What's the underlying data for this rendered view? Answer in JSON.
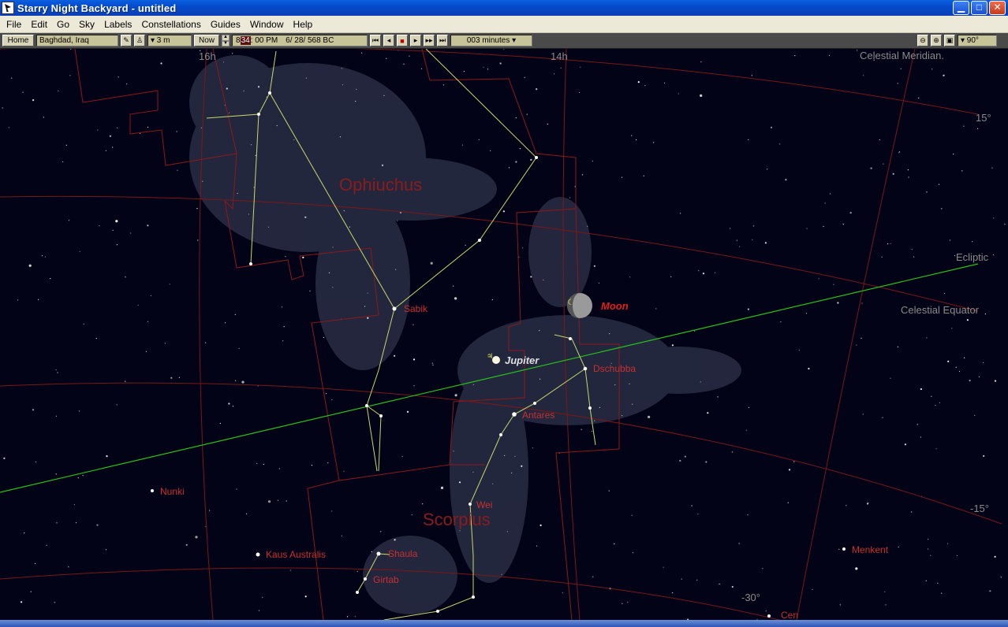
{
  "window": {
    "title": "Starry Night Backyard - untitled",
    "buttons": {
      "minimize": "▁",
      "maximize": "□",
      "close": "✕"
    }
  },
  "menu": [
    "File",
    "Edit",
    "Go",
    "Sky",
    "Labels",
    "Constellations",
    "Guides",
    "Window",
    "Help"
  ],
  "toolbar": {
    "home_label": "Home",
    "location": "Baghdad, Iraq",
    "elevation": "▾ 3 m",
    "now_label": "Now",
    "time_hour": "8",
    "time_minute": "34",
    "time_rest": ": 00 PM",
    "date": "6/ 28/  568 BC",
    "time_step": "003 minutes ▾",
    "field_of_view": "▾ 90°"
  },
  "sky": {
    "ra_labels": [
      "16h",
      "14h"
    ],
    "dec_labels": [
      "15°",
      "-15°",
      "-30°"
    ],
    "guide_labels": [
      "Celestial Meridian.",
      "Ecliptic",
      "Celestial Equator"
    ],
    "constellations": [
      "Ophiuchus",
      "Scorpius"
    ],
    "planets": [
      "Jupiter",
      "Moon"
    ],
    "stars": [
      "Sabik",
      "Dschubba",
      "Antares",
      "Wei",
      "Shaula",
      "Girtab",
      "Kaus Australis",
      "Nunki",
      "Menkent",
      "Cen"
    ],
    "colors": {
      "background": "#020316",
      "boundary": "#8b1a1a",
      "stick": "#c8d86a",
      "ecliptic": "#27c41a",
      "label_red": "#c83030",
      "guide": "#8a8a8a"
    }
  }
}
